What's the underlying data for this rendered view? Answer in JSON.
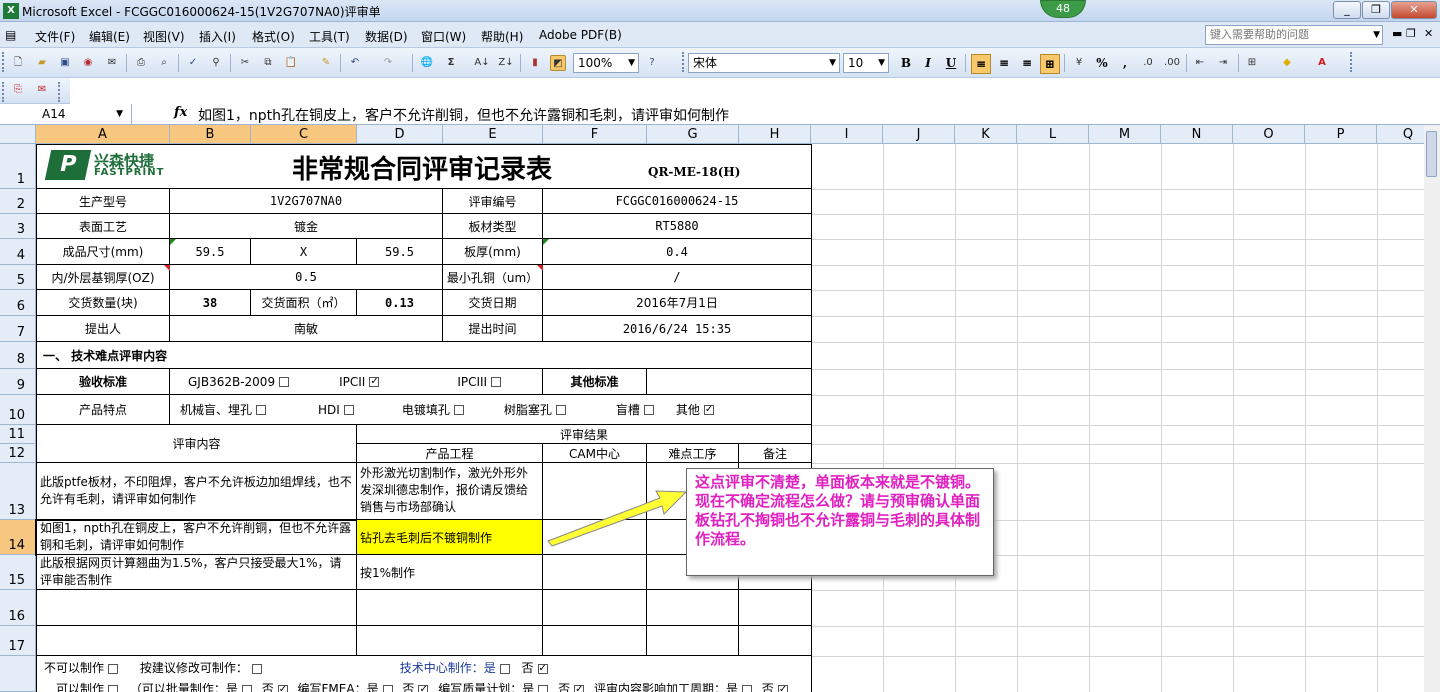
{
  "window": {
    "title": "Microsoft Excel - FCGGC016000624-15(1V2G707NA0)评审单",
    "badge": "48",
    "min": "_",
    "restore": "❐",
    "close": "✕"
  },
  "menu": {
    "items": [
      "文件(F)",
      "编辑(E)",
      "视图(V)",
      "插入(I)",
      "格式(O)",
      "工具(T)",
      "数据(D)",
      "窗口(W)",
      "帮助(H)",
      "Adobe PDF(B)"
    ],
    "help_placeholder": "键入需要帮助的问题"
  },
  "toolbar": {
    "zoom": "100%",
    "font_name": "宋体",
    "font_size": "10",
    "bold": "B",
    "italic": "I",
    "underline": "U",
    "percent": "%",
    "comma": ","
  },
  "formula_bar": {
    "name_box": "A14",
    "fx": "fx",
    "content": "如图1，npth孔在铜皮上，客户不允许削铜，但也不允许露铜和毛刺，请评审如何制作"
  },
  "columns": [
    "A",
    "B",
    "C",
    "D",
    "E",
    "F",
    "G",
    "H",
    "I",
    "J",
    "K",
    "L",
    "M",
    "N",
    "O",
    "P",
    "Q"
  ],
  "rows": [
    "1",
    "2",
    "3",
    "4",
    "5",
    "6",
    "7",
    "8",
    "9",
    "10",
    "11",
    "12",
    "13",
    "14",
    "15",
    "16",
    "17"
  ],
  "sheet": {
    "logo_cn": "兴森快捷",
    "logo_en": "FASTPRINT",
    "logo_mark": "P",
    "title": "非常规合同评审记录表",
    "code": "QR-ME-18(H)",
    "r2": {
      "a": "生产型号",
      "b": "1V2G707NA0",
      "e": "评审编号",
      "f": "FCGGC016000624-15"
    },
    "r3": {
      "a": "表面工艺",
      "b": "镀金",
      "e": "板材类型",
      "f": "RT5880"
    },
    "r4": {
      "a": "成品尺寸(mm)",
      "b": "59.5",
      "c": "X",
      "d": "59.5",
      "e": "板厚(mm)",
      "f": "0.4"
    },
    "r5": {
      "a": "内/外层基铜厚(OZ)",
      "b": "0.5",
      "e": "最小孔铜（um）",
      "f": "/"
    },
    "r6": {
      "a": "交货数量(块)",
      "b": "38",
      "c": "交货面积（㎡）",
      "d": "0.13",
      "e": "交货日期",
      "f": "2016年7月1日"
    },
    "r7": {
      "a": "提出人",
      "b": "南敏",
      "e": "提出时间",
      "f": "2016/6/24 15:35"
    },
    "r8": {
      "a": "一、 技术难点评审内容"
    },
    "r9": {
      "a": "验收标准",
      "b": "GJB362B-2009",
      "d": "IPCII",
      "e": "IPCIII",
      "f_label": "其他标准"
    },
    "r10": {
      "a": "产品特点",
      "b": "机械盲、埋孔",
      "d": "HDI",
      "e": "电镀填孔",
      "f": "树脂塞孔",
      "g": "盲槽",
      "h": "其他"
    },
    "r11": {
      "a": "评审内容",
      "d": "评审结果"
    },
    "r12": {
      "d": "产品工程",
      "f": "CAM中心",
      "g": "难点工序",
      "h": "备注"
    },
    "r13": {
      "a": "此版ptfe板材，不印阻焊，客户不允许板边加组焊线，也不允许有毛刺，请评审如何制作",
      "d": "外形激光切割制作，激光外形外发深圳德忠制作，报价请反馈给销售与市场部确认"
    },
    "r14": {
      "a": "如图1，npth孔在铜皮上，客户不允许削铜，但也不允许露铜和毛刺，请评审如何制作",
      "d": "钻孔去毛刺后不镀铜制作"
    },
    "r15": {
      "a": "此版根据网页计算翘曲为1.5%，客户只接受最大1%，请评审能否制作",
      "d": "按1%制作"
    },
    "bottom1": {
      "a": "不可以制作",
      "b": "按建议修改可制作：",
      "c": "技术中心制作：是",
      "d": "否"
    },
    "bottom2": {
      "a": "可以制作",
      "b": "（可以批量制作：是",
      "c": "否",
      "d": "编写FMEA：是",
      "e": "否",
      "f": "编写质量计划：是",
      "g": "否",
      "h": "评审内容影响加工周期：是",
      "i": "否"
    },
    "check": "✓"
  },
  "callout": {
    "text": "这点评审不清楚，单面板本来就是不镀铜。现在不确定流程怎么做？请与预审确认单面板钻孔不掏铜也不允许露铜与毛刺的具体制作流程。"
  }
}
